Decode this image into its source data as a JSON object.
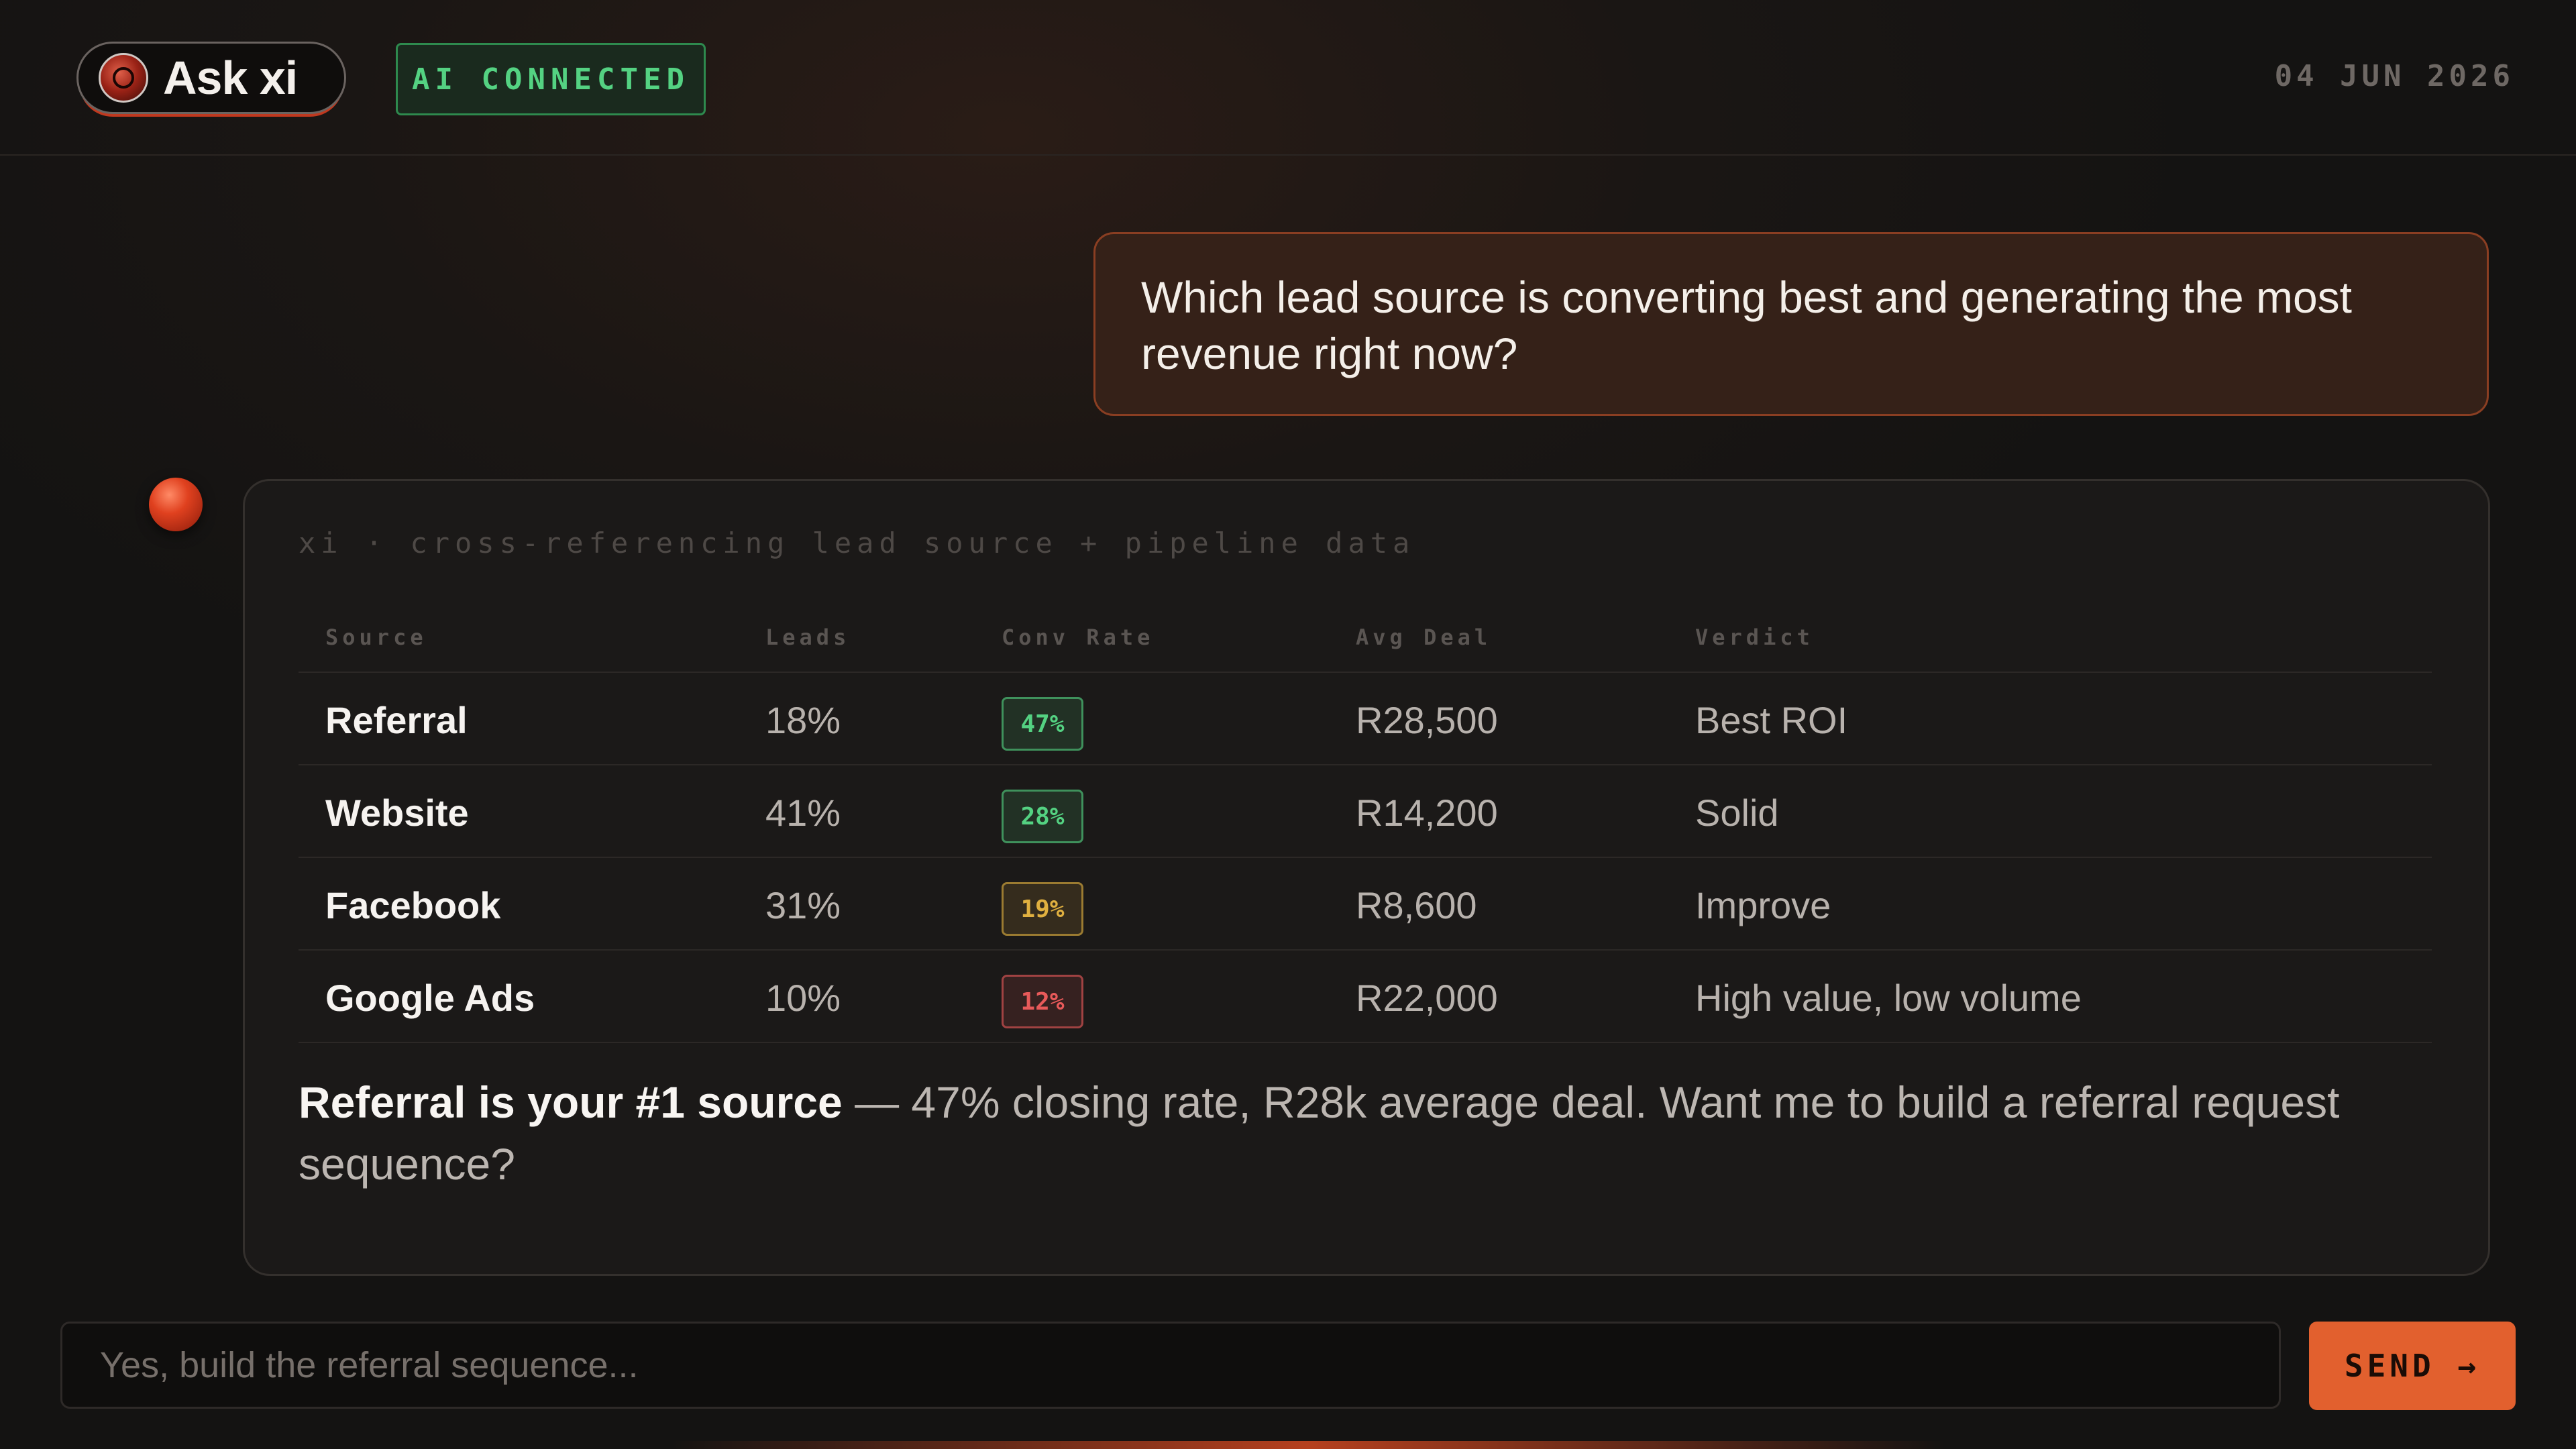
{
  "header": {
    "app_name": "Ask xi",
    "status": "AI CONNECTED",
    "date": "04 JUN 2026"
  },
  "colors": {
    "accent": "#e2602e",
    "status_green": "#54d282",
    "rate_high": "#54d282",
    "rate_mid": "#e0b040",
    "rate_low": "#e85a5a"
  },
  "conversation": {
    "user_message": "Which lead source is converting best and generating the most revenue right now?",
    "ai": {
      "caption": "xi · cross-referencing lead source + pipeline data",
      "table": {
        "headers": {
          "source": "Source",
          "leads": "Leads",
          "conv_rate": "Conv Rate",
          "avg_deal": "Avg Deal",
          "verdict": "Verdict"
        },
        "rows": [
          {
            "source": "Referral",
            "leads": "18%",
            "conv_rate": "47%",
            "avg_deal": "R28,500",
            "verdict": "Best ROI",
            "tone": "high"
          },
          {
            "source": "Website",
            "leads": "41%",
            "conv_rate": "28%",
            "avg_deal": "R14,200",
            "verdict": "Solid",
            "tone": "high"
          },
          {
            "source": "Facebook",
            "leads": "31%",
            "conv_rate": "19%",
            "avg_deal": "R8,600",
            "verdict": "Improve",
            "tone": "mid"
          },
          {
            "source": "Google Ads",
            "leads": "10%",
            "conv_rate": "12%",
            "avg_deal": "R22,000",
            "verdict": "High value, low volume",
            "tone": "low"
          }
        ]
      },
      "summary": {
        "lead": "Referral is your #1 source",
        "rest": " — 47% closing rate, R28k average deal. Want me to build a referral request sequence?"
      }
    }
  },
  "composer": {
    "value": "Yes, build the referral sequence...",
    "send_label": "SEND →"
  }
}
